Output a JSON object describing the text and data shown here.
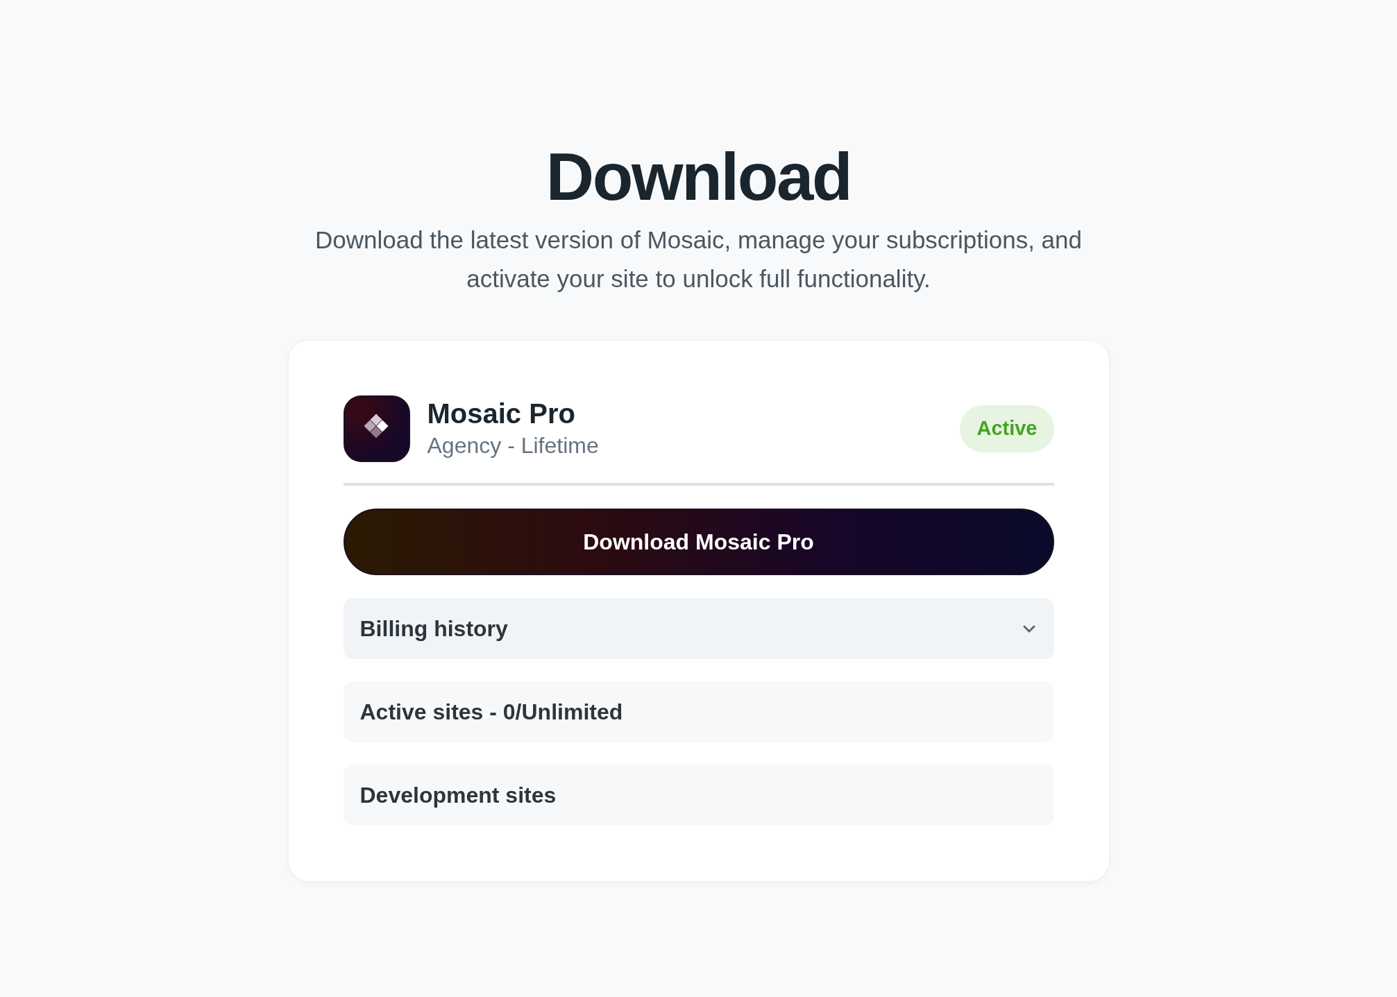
{
  "header": {
    "title": "Download",
    "subtitle": "Download the latest version of Mosaic, manage your subscriptions, and activate your site to unlock full functionality."
  },
  "product": {
    "name": "Mosaic Pro",
    "plan": "Agency - Lifetime",
    "status": "Active"
  },
  "download_button": "Download Mosaic Pro",
  "sections": [
    {
      "kind": "expandable",
      "label": "Billing history",
      "expanded": false
    },
    {
      "kind": "static",
      "label": "Active sites - 0/Unlimited"
    },
    {
      "kind": "static",
      "label": "Development sites"
    }
  ]
}
